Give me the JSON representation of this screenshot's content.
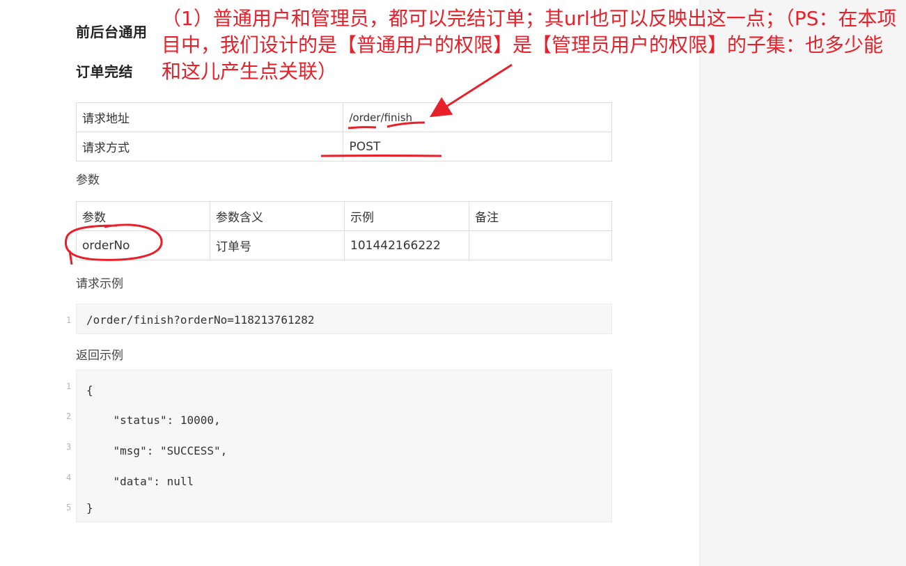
{
  "section": {
    "category": "前后台通用",
    "title": "订单完结"
  },
  "request_table": {
    "rows": [
      {
        "key": "请求地址",
        "value": "/order/finish"
      },
      {
        "key": "请求方式",
        "value": "POST"
      }
    ]
  },
  "params_label": "参数",
  "params_table": {
    "headers": [
      "参数",
      "参数含义",
      "示例",
      "备注"
    ],
    "rows": [
      [
        "orderNo",
        "订单号",
        "101442166222",
        ""
      ]
    ]
  },
  "request_example": {
    "label": "请求示例",
    "lines": [
      "/order/finish?orderNo=118213761282"
    ],
    "line_numbers": [
      "1"
    ]
  },
  "response_example": {
    "label": "返回示例",
    "lines": [
      "{",
      "    \"status\": 10000,",
      "    \"msg\": \"SUCCESS\",",
      "    \"data\": null",
      "}"
    ],
    "line_numbers": [
      "1",
      "2",
      "3",
      "4",
      "5"
    ]
  },
  "annotation": {
    "text": "（1）普通用户和管理员，都可以完结订单；其url也可以反映出这一点；（PS：在本项目中，我们设计的是【普通用户的权限】是【管理员用户的权限】的子集：也多少能和这儿产生点关联）",
    "color": "#e8202a"
  }
}
